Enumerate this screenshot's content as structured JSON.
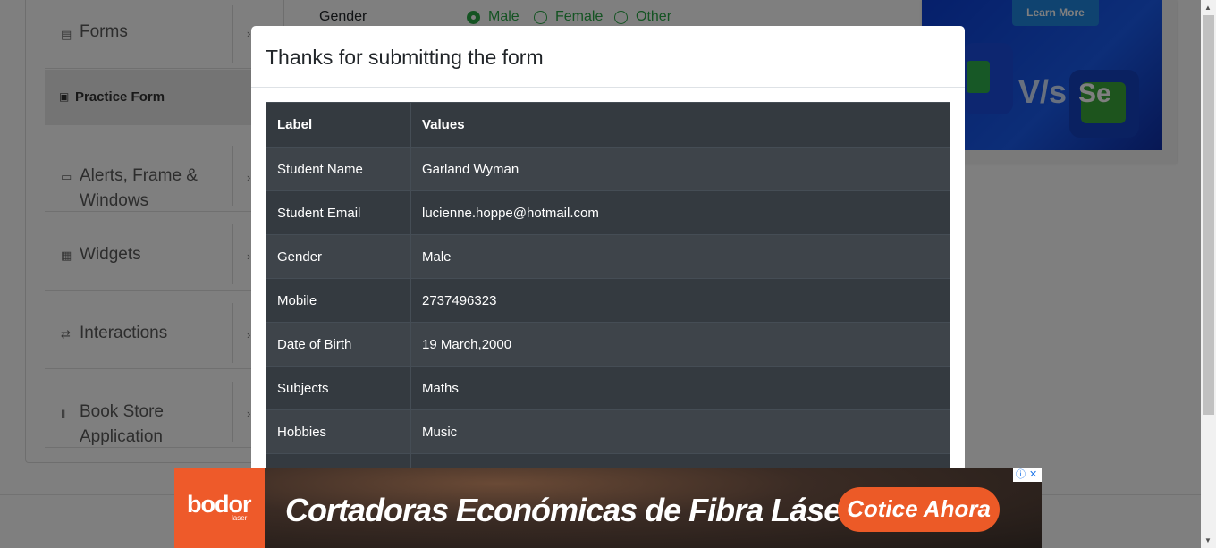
{
  "sidebar": {
    "groups": [
      {
        "label": "Forms",
        "icon": "document-icon"
      },
      {
        "label": "Alerts, Frame & Windows",
        "icon": "window-icon"
      },
      {
        "label": "Widgets",
        "icon": "widgets-icon"
      },
      {
        "label": "Interactions",
        "icon": "interactions-icon"
      },
      {
        "label": "Book Store Application",
        "icon": "books-icon"
      }
    ],
    "active_item": "Practice Form"
  },
  "form": {
    "gender_label": "Gender",
    "gender_options": [
      "Male",
      "Female",
      "Other"
    ],
    "selected_gender": "Male"
  },
  "top_ad": {
    "button_label": "Learn More",
    "vs_text": "V/s",
    "se_text": "Se"
  },
  "modal": {
    "title": "Thanks for submitting the form",
    "columns": [
      "Label",
      "Values"
    ],
    "rows": [
      {
        "label": "Student Name",
        "value": "Garland Wyman"
      },
      {
        "label": "Student Email",
        "value": "lucienne.hoppe@hotmail.com"
      },
      {
        "label": "Gender",
        "value": "Male"
      },
      {
        "label": "Mobile",
        "value": "2737496323"
      },
      {
        "label": "Date of Birth",
        "value": "19 March,2000"
      },
      {
        "label": "Subjects",
        "value": "Maths"
      },
      {
        "label": "Hobbies",
        "value": "Music"
      }
    ]
  },
  "bottom_ad": {
    "brand": "bodor",
    "brand_sub": "laser",
    "headline": "Cortadoras Económicas de Fibra Láser",
    "cta": "Cotice Ahora"
  },
  "colors": {
    "accent_green": "#28a745",
    "table_dark": "#343a40",
    "ad_orange": "#ec5a27"
  }
}
